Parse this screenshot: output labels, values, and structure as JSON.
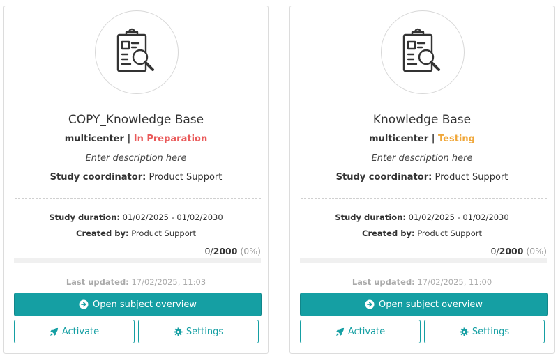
{
  "colors": {
    "accent": "#159fa3",
    "status_in_preparation": "#ea5a5a",
    "status_testing": "#f0a73a"
  },
  "cards": [
    {
      "icon": "clipboard-search-icon",
      "title": "COPY_Knowledge Base",
      "type": "multicenter",
      "separator": " | ",
      "status": "In Preparation",
      "description": "Enter description here",
      "coordinator_label": "Study coordinator:",
      "coordinator": "Product Support",
      "duration_label": "Study duration:",
      "duration": "01/02/2025 - 01/02/2030",
      "created_label": "Created by:",
      "created_by": "Product Support",
      "enrolled": "0",
      "target": "2000",
      "percent": "(0%)",
      "progress": 0,
      "updated_label": "Last updated:",
      "updated": "17/02/2025, 11:03",
      "open_label": "Open subject overview",
      "activate_label": "Activate",
      "settings_label": "Settings"
    },
    {
      "icon": "clipboard-search-icon",
      "title": "Knowledge Base",
      "type": "multicenter",
      "separator": " | ",
      "status": "Testing",
      "description": "Enter description here",
      "coordinator_label": "Study coordinator:",
      "coordinator": "Product Support",
      "duration_label": "Study duration:",
      "duration": "01/02/2025 - 01/02/2030",
      "created_label": "Created by:",
      "created_by": "Product Support",
      "enrolled": "0",
      "target": "2000",
      "percent": "(0%)",
      "progress": 0,
      "updated_label": "Last updated:",
      "updated": "17/02/2025, 11:00",
      "open_label": "Open subject overview",
      "activate_label": "Activate",
      "settings_label": "Settings"
    }
  ]
}
